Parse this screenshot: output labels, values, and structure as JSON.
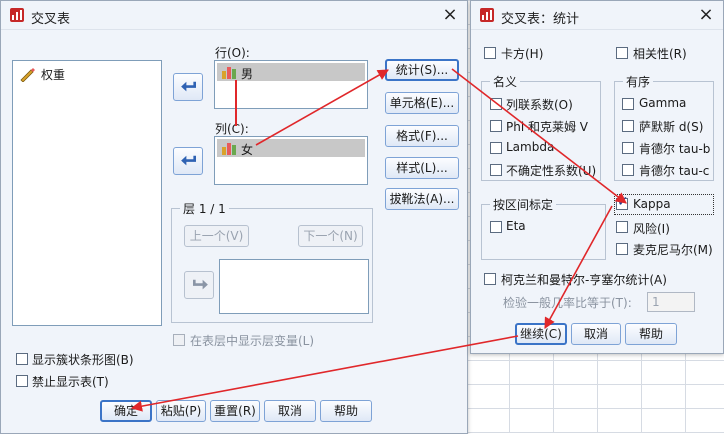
{
  "crosstabs": {
    "title": "交叉表",
    "source_list": [
      "权重"
    ],
    "row_label": "行(O):",
    "row_items": [
      "男"
    ],
    "col_label": "列(C):",
    "col_items": [
      "女"
    ],
    "layer_title": "层 1 / 1",
    "prev_label": "上一个(V)",
    "next_label": "下一个(N)",
    "show_layers_label": "在表层中显示层变量(L)",
    "show_clustered_bar_label": "显示簇状条形图(B)",
    "suppress_tables_label": "禁止显示表(T)",
    "side_buttons": {
      "statistics": "统计(S)...",
      "cells": "单元格(E)...",
      "format": "格式(F)...",
      "style": "样式(L)...",
      "bootstrap": "拔靴法(A)..."
    },
    "footer": {
      "ok": "确定",
      "paste": "粘贴(P)",
      "reset": "重置(R)",
      "cancel": "取消",
      "help": "帮助"
    }
  },
  "statistics": {
    "title": "交叉表：统计",
    "chisq": "卡方(H)",
    "correlations": "相关性(R)",
    "nominal_title": "名义",
    "nominal": [
      "列联系数(O)",
      "Phi 和克莱姆 V",
      "Lambda",
      "不确定性系数(U)"
    ],
    "ordinal_title": "有序",
    "ordinal": [
      "Gamma",
      "萨默斯 d(S)",
      "肯德尔 tau-b",
      "肯德尔 tau-c"
    ],
    "interval_title": "按区间标定",
    "interval": [
      "Eta"
    ],
    "kappa": "Kappa",
    "risk": "风险(I)",
    "mcnemar": "麦克尼马尔(M)",
    "cmh": "柯克兰和曼特尔-亨塞尔统计(A)",
    "cmh_test_label": "检验一般几率比等于(T):",
    "cmh_test_value": "1",
    "footer": {
      "continue": "继续(C)",
      "cancel": "取消",
      "help": "帮助"
    }
  },
  "colors": {
    "window_bg": "#f0f4fa",
    "button_border": "#7ea3d6",
    "annotation_arrow": "#e0272a"
  }
}
